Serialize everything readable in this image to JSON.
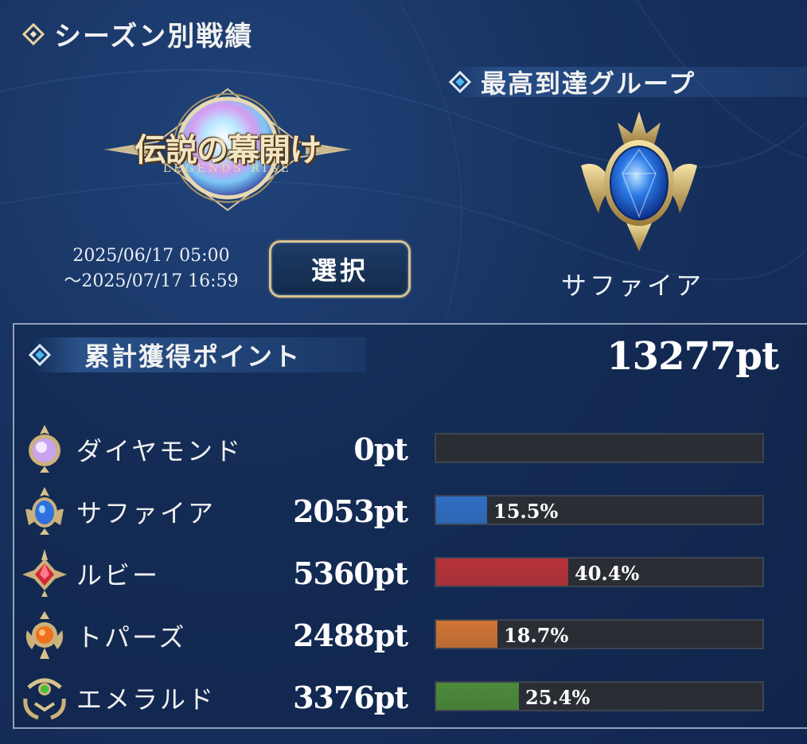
{
  "season_section": {
    "title": "シーズン別戦績",
    "logo_title": "伝説の幕開け",
    "logo_subtitle": "LEGENDS RISE",
    "date_start": "2025/06/17 05:00",
    "date_end": "～2025/07/17 16:59",
    "select_button_label": "選択"
  },
  "top_group": {
    "title": "最高到達グループ",
    "group_name": "サファイア",
    "emblem_icon": "sapphire-emblem-icon"
  },
  "points": {
    "title": "累計獲得ポイント",
    "total": "13277pt",
    "rows": [
      {
        "label": "ダイヤモンド",
        "points": "0pt",
        "percent_label": "",
        "share": 0.0,
        "color": "#9a6fcf",
        "icon": "diamond-gem-icon"
      },
      {
        "label": "サファイア",
        "points": "2053pt",
        "percent_label": "15.5%",
        "share": 0.155,
        "color": "#2f6fc4",
        "icon": "sapphire-gem-icon"
      },
      {
        "label": "ルビー",
        "points": "5360pt",
        "percent_label": "40.4%",
        "share": 0.404,
        "color": "#b8323a",
        "icon": "ruby-gem-icon"
      },
      {
        "label": "トパーズ",
        "points": "2488pt",
        "percent_label": "18.7%",
        "share": 0.187,
        "color": "#d07434",
        "icon": "topaz-gem-icon"
      },
      {
        "label": "エメラルド",
        "points": "3376pt",
        "percent_label": "25.4%",
        "share": 0.254,
        "color": "#4d8a3a",
        "icon": "emerald-gem-icon"
      }
    ]
  }
}
